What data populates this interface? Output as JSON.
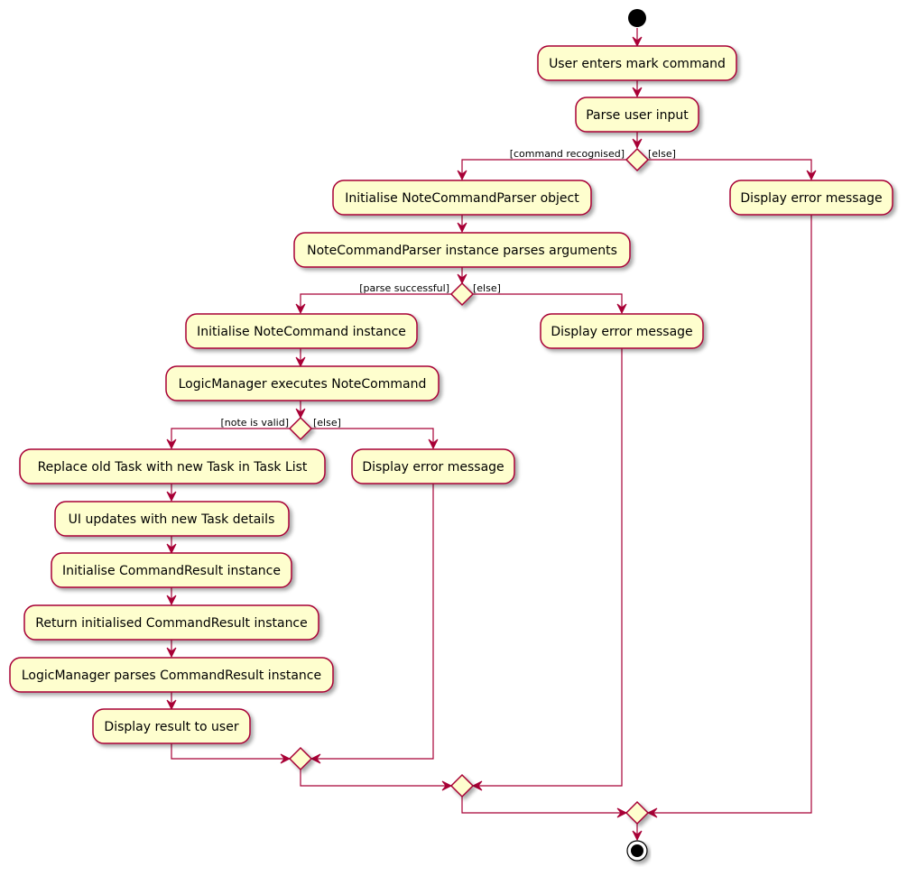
{
  "diagram": {
    "type": "activity",
    "colors": {
      "node_fill": "#FEFECE",
      "border": "#A80036",
      "start": "#000000"
    },
    "nodes": {
      "n1": "User enters mark command",
      "n2": "Parse user input",
      "n3": "Initialise NoteCommandParser object",
      "n4": "NoteCommandParser instance parses arguments",
      "n5": "Initialise NoteCommand instance",
      "n6": "LogicManager executes NoteCommand",
      "n7": "Replace old Task with new Task in Task List",
      "n8": "UI updates with new Task details",
      "n9": "Initialise CommandResult instance",
      "n10": "Return initialised CommandResult instance",
      "n11": "LogicManager parses CommandResult instance",
      "n12": "Display result to user",
      "e1": "Display error message",
      "e2": "Display error message",
      "e3": "Display error message"
    },
    "guards": {
      "d1_yes": "[command recognised]",
      "d1_no": "[else]",
      "d2_yes": "[parse successful]",
      "d2_no": "[else]",
      "d3_yes": "[note is valid]",
      "d3_no": "[else]"
    }
  }
}
